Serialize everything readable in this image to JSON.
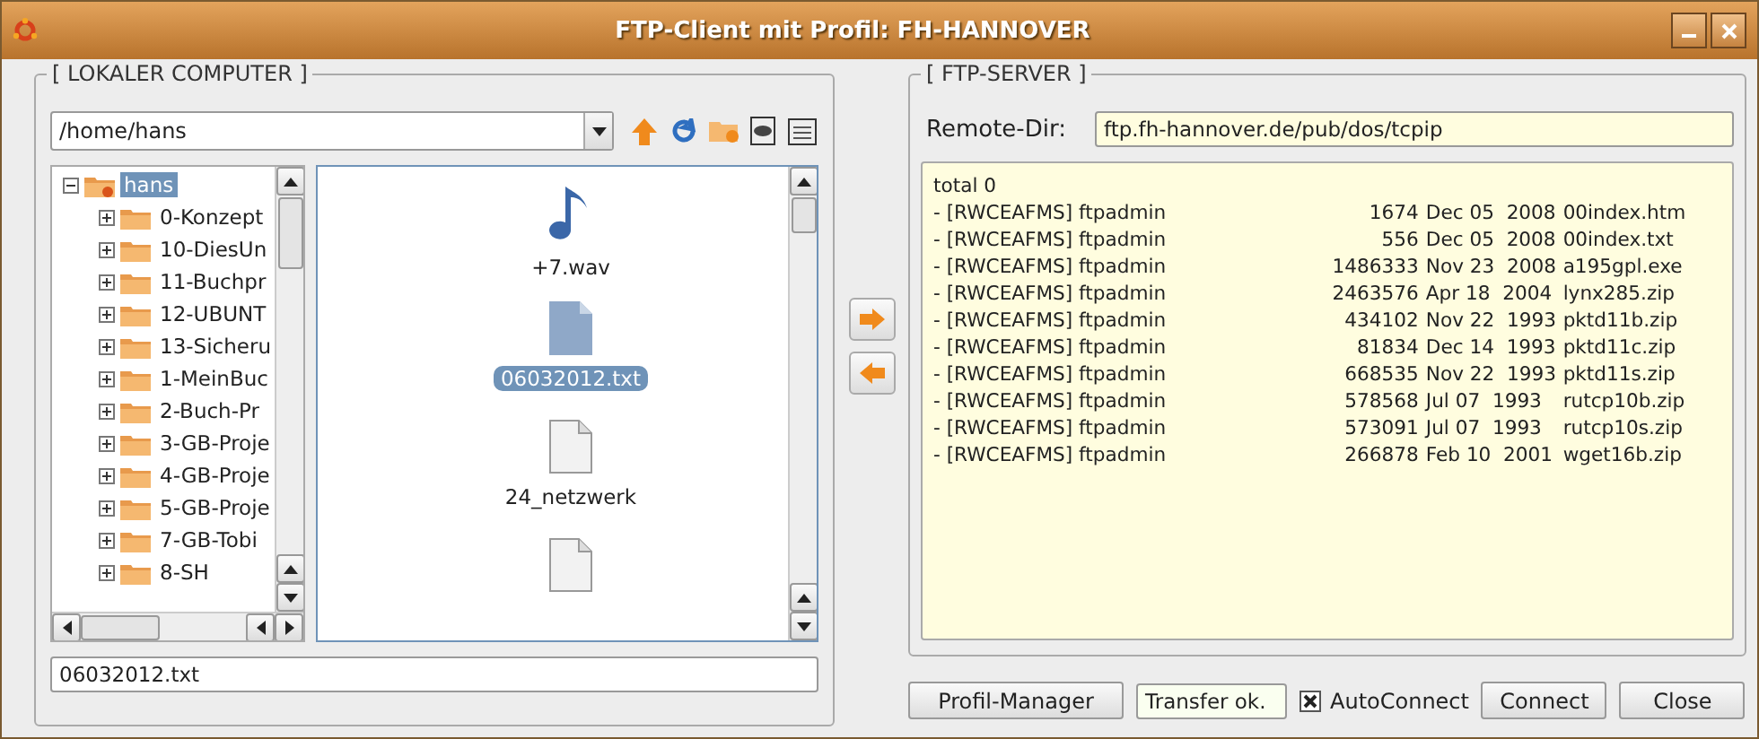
{
  "window": {
    "title": "FTP-Client mit Profil: FH-HANNOVER"
  },
  "local": {
    "legend": "[ LOKALER COMPUTER ]",
    "path": "/home/hans",
    "tree": {
      "label": "hans",
      "expanded": true,
      "selected": true,
      "children": [
        {
          "label": "0-Konzept",
          "expanded": false
        },
        {
          "label": "10-DiesUn",
          "expanded": false
        },
        {
          "label": "11-Buchpr",
          "expanded": false
        },
        {
          "label": "12-UBUNT",
          "expanded": false
        },
        {
          "label": "13-Sicheru",
          "expanded": false
        },
        {
          "label": "1-MeinBuc",
          "expanded": false
        },
        {
          "label": "2-Buch-Pr",
          "expanded": false
        },
        {
          "label": "3-GB-Proje",
          "expanded": false
        },
        {
          "label": "4-GB-Proje",
          "expanded": false
        },
        {
          "label": "5-GB-Proje",
          "expanded": false
        },
        {
          "label": "7-GB-Tobi",
          "expanded": false
        },
        {
          "label": "8-SH",
          "expanded": false
        }
      ]
    },
    "files": [
      {
        "kind": "audio",
        "label": "+7.wav",
        "selected": false
      },
      {
        "kind": "text",
        "label": "06032012.txt",
        "selected": true
      },
      {
        "kind": "document",
        "label": "24_netzwerk",
        "selected": false
      },
      {
        "kind": "document",
        "selected": false
      }
    ],
    "filename": "06032012.txt"
  },
  "server": {
    "legend": "[ FTP-SERVER ]",
    "remote_label": "Remote-Dir:",
    "remote_dir": "ftp.fh-hannover.de/pub/dos/tcpip",
    "header": "total 0",
    "listing": [
      {
        "owner": "- [RWCEAFMS] ftpadmin",
        "size": "1674",
        "date": "Dec 05  2008",
        "name": "00index.htm"
      },
      {
        "owner": "- [RWCEAFMS] ftpadmin",
        "size": "556",
        "date": "Dec 05  2008",
        "name": "00index.txt"
      },
      {
        "owner": "- [RWCEAFMS] ftpadmin",
        "size": "1486333",
        "date": "Nov 23  2008",
        "name": "a195gpl.exe"
      },
      {
        "owner": "- [RWCEAFMS] ftpadmin",
        "size": "2463576",
        "date": "Apr 18  2004",
        "name": "lynx285.zip"
      },
      {
        "owner": "- [RWCEAFMS] ftpadmin",
        "size": "434102",
        "date": "Nov 22  1993",
        "name": "pktd11b.zip"
      },
      {
        "owner": "- [RWCEAFMS] ftpadmin",
        "size": "81834",
        "date": "Dec 14  1993",
        "name": "pktd11c.zip"
      },
      {
        "owner": "- [RWCEAFMS] ftpadmin",
        "size": "668535",
        "date": "Nov 22  1993",
        "name": "pktd11s.zip"
      },
      {
        "owner": "- [RWCEAFMS] ftpadmin",
        "size": "578568",
        "date": "Jul 07  1993",
        "name": "rutcp10b.zip"
      },
      {
        "owner": "- [RWCEAFMS] ftpadmin",
        "size": "573091",
        "date": "Jul 07  1993",
        "name": "rutcp10s.zip"
      },
      {
        "owner": "- [RWCEAFMS] ftpadmin",
        "size": "266878",
        "date": "Feb 10  2001",
        "name": "wget16b.zip"
      }
    ]
  },
  "footer": {
    "profile_button": "Profil-Manager",
    "status": "Transfer ok.",
    "autoconnect": {
      "label": "AutoConnect",
      "checked": true
    },
    "buttons": [
      "Connect",
      "Close"
    ]
  }
}
